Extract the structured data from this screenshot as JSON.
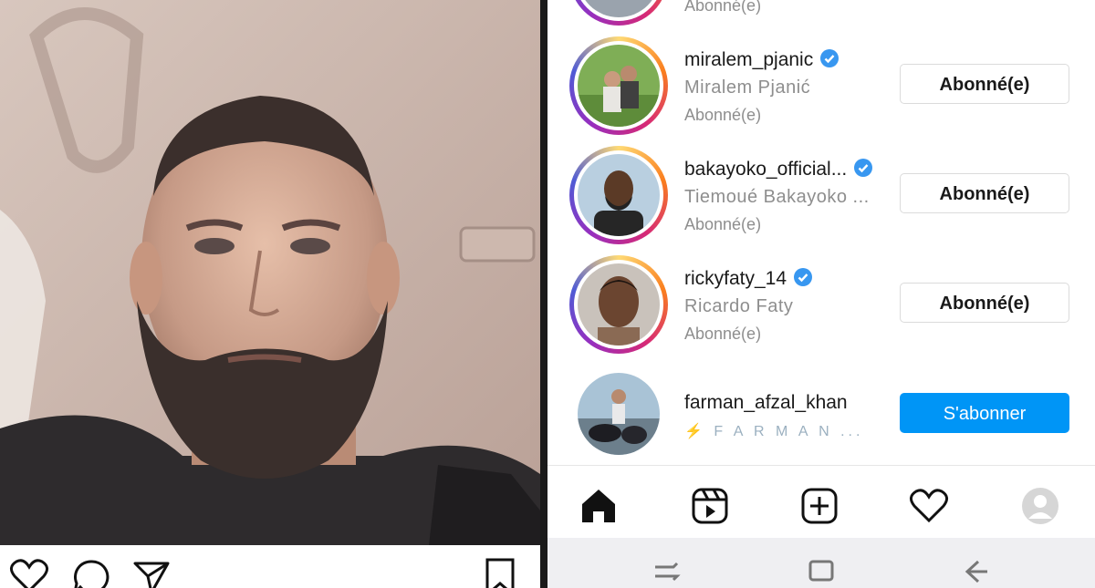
{
  "left_post": {
    "photo": "selfie-photo",
    "actions": [
      "heart-icon",
      "comment-icon",
      "send-icon",
      "bookmark-icon"
    ]
  },
  "list": {
    "rows": [
      {
        "username": "",
        "fullname": "",
        "status": "Abonné(e)",
        "button": ""
      },
      {
        "username": "miralem_pjanic",
        "fullname": "Miralem Pjanić",
        "status": "Abonné(e)",
        "button": "Abonné(e)",
        "verified": true
      },
      {
        "username": "bakayoko_official...",
        "fullname": "Tiemoué Bakayoko ...",
        "status": "Abonné(e)",
        "button": "Abonné(e)",
        "verified": true
      },
      {
        "username": "rickyfaty_14",
        "fullname": "Ricardo Faty",
        "status": "Abonné(e)",
        "button": "Abonné(e)",
        "verified": true
      },
      {
        "username": "farman_afzal_khan",
        "fullname": "⚡ F A R M A N ...",
        "status": "",
        "button": "S'abonner",
        "verified": false
      }
    ]
  },
  "tabbar": [
    "home-icon",
    "reels-icon",
    "new-post-icon",
    "activity-icon",
    "profile-icon"
  ],
  "navbar": [
    "recent-apps-icon",
    "home-button-icon",
    "back-icon"
  ],
  "colors": {
    "accent": "#0095f6",
    "verified": "#3897f0",
    "muted": "#8e8e8e"
  }
}
